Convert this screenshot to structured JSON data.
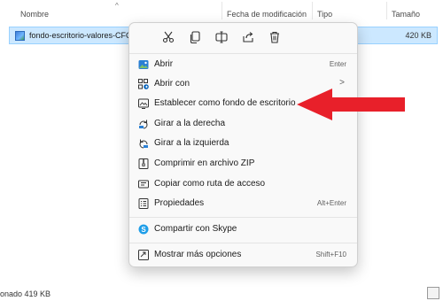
{
  "header": {
    "col_name": "Nombre",
    "col_date": "Fecha de modificación",
    "col_type": "Tipo",
    "col_size": "Tamaño"
  },
  "file": {
    "name": "fondo-escritorio-valores-CFC-s",
    "size": "420 KB"
  },
  "status": {
    "text": "onado  419 KB"
  },
  "menu": {
    "toolbar": [
      "cut-icon",
      "copy-icon",
      "rename-icon",
      "share-icon",
      "delete-icon"
    ],
    "items": [
      {
        "label": "Abrir",
        "shortcut": "Enter",
        "icon": "image-icon"
      },
      {
        "label": "Abrir con",
        "shortcut": "",
        "icon": "open-with-icon",
        "submenu": ">"
      },
      {
        "label": "Establecer como fondo de escritorio",
        "shortcut": "",
        "icon": "wallpaper-icon"
      },
      {
        "label": "Girar a la derecha",
        "shortcut": "",
        "icon": "rotate-right-icon"
      },
      {
        "label": "Girar a la izquierda",
        "shortcut": "",
        "icon": "rotate-left-icon"
      },
      {
        "label": "Comprimir en archivo ZIP",
        "shortcut": "",
        "icon": "zip-icon"
      },
      {
        "label": "Copiar como ruta de acceso",
        "shortcut": "",
        "icon": "copy-path-icon"
      },
      {
        "label": "Propiedades",
        "shortcut": "Alt+Enter",
        "icon": "properties-icon"
      },
      {
        "label": "Compartir con Skype",
        "shortcut": "",
        "icon": "skype-icon"
      },
      {
        "label": "Mostrar más opciones",
        "shortcut": "Shift+F10",
        "icon": "more-options-icon"
      }
    ]
  },
  "colors": {
    "selection_bg": "#cce8ff",
    "accent": "#005fb8",
    "arrow": "#e8202a"
  }
}
